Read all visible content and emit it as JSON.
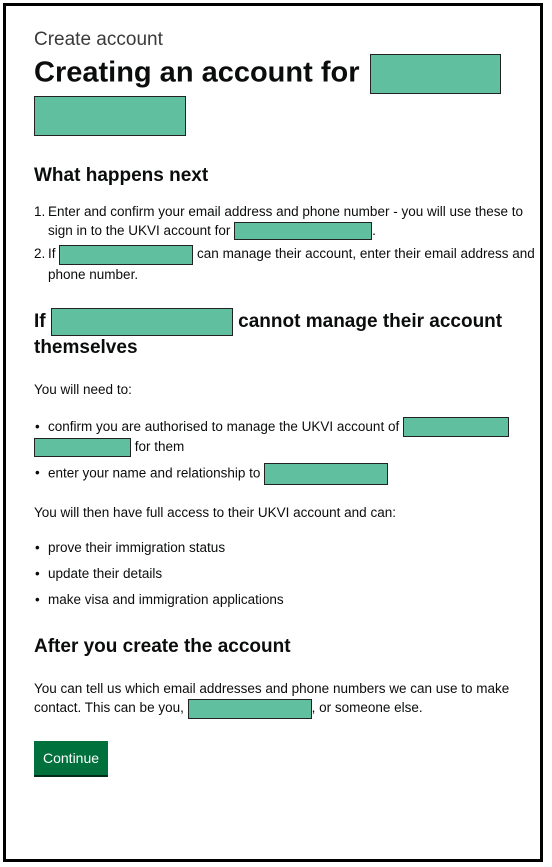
{
  "header": {
    "caption": "Create account",
    "title_prefix": "Creating an account for"
  },
  "next_steps": {
    "heading": "What happens next",
    "items": [
      {
        "num": "1.",
        "text_before": "Enter and confirm your email address and phone number - you will use these to sign in to the UKVI account for",
        "text_after": "."
      },
      {
        "num": "2.",
        "text_before": "If",
        "text_after": "can manage their account, enter their email address and phone number."
      }
    ]
  },
  "cannot_manage": {
    "heading_prefix": "If",
    "heading_suffix": "cannot manage their account themselves",
    "intro": "You will need to:",
    "items": [
      {
        "text_before": "confirm you are authorised to manage the UKVI account of",
        "text_after": "for them"
      },
      {
        "text_before": "enter your name and relationship to"
      }
    ],
    "access_text": "You will then have full access to their UKVI account and can:",
    "access_items": [
      "prove their immigration status",
      "update their details",
      "make visa and immigration applications"
    ]
  },
  "after": {
    "heading": "After you create the account",
    "text_before": "You can tell us which email addresses and phone numbers we can use to make contact. This can be you,",
    "text_after": ", or someone else."
  },
  "actions": {
    "continue_label": "Continue"
  },
  "colors": {
    "redaction": "#5fbf9f",
    "button": "#00703c",
    "text": "#0b0c0c"
  }
}
